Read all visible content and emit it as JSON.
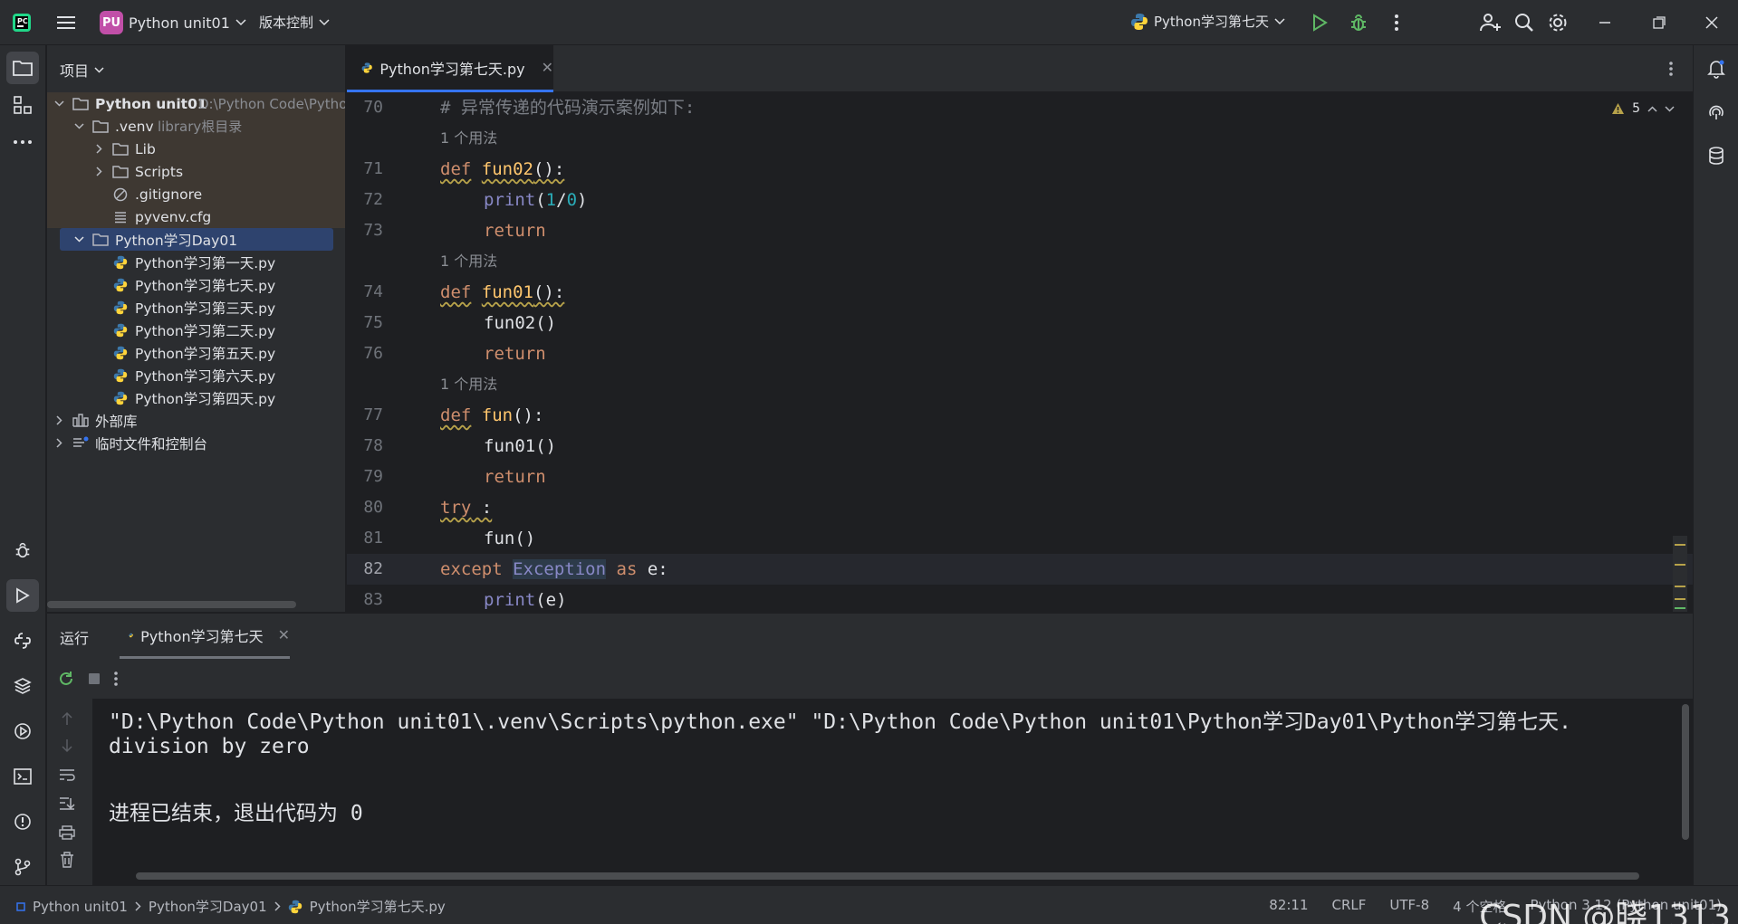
{
  "titlebar": {
    "project_badge": "PU",
    "project_name": "Python unit01",
    "vcs_label": "版本控制",
    "run_config": "Python学习第七天"
  },
  "project_panel": {
    "header": "项目",
    "root": {
      "name": "Python unit01",
      "path": "D:\\Python Code\\Pytho"
    },
    "venv": {
      "name": ".venv",
      "note": "library根目录"
    },
    "lib": "Lib",
    "scripts": "Scripts",
    "gitignore": ".gitignore",
    "pyvenv": "pyvenv.cfg",
    "day_folder": "Python学习Day01",
    "files": [
      "Python学习第一天.py",
      "Python学习第七天.py",
      "Python学习第三天.py",
      "Python学习第二天.py",
      "Python学习第五天.py",
      "Python学习第六天.py",
      "Python学习第四天.py"
    ],
    "external_libs": "外部库",
    "scratches": "临时文件和控制台"
  },
  "editor": {
    "tab_label": "Python学习第七天.py",
    "warning_count": "5",
    "usage_hint": "1 个用法",
    "lines": {
      "l70": {
        "num": "70",
        "text": "# 异常传递的代码演示案例如下:"
      },
      "l71": {
        "num": "71",
        "kw": "def",
        "fn": "fun02",
        "rest": "():"
      },
      "l72": {
        "num": "72",
        "call": "print",
        "open": "(",
        "a": "1",
        "op": "/",
        "b": "0",
        "close": ")"
      },
      "l73": {
        "num": "73",
        "kw": "return"
      },
      "l74": {
        "num": "74",
        "kw": "def",
        "fn": "fun01",
        "rest": "():"
      },
      "l75": {
        "num": "75",
        "text": "fun02()"
      },
      "l76": {
        "num": "76",
        "kw": "return"
      },
      "l77": {
        "num": "77",
        "kw": "def",
        "fn": "fun",
        "rest": "():"
      },
      "l78": {
        "num": "78",
        "text": "fun01()"
      },
      "l79": {
        "num": "79",
        "kw": "return"
      },
      "l80": {
        "num": "80",
        "kw": "try",
        "rest": " :"
      },
      "l81": {
        "num": "81",
        "text": "fun()"
      },
      "l82": {
        "num": "82",
        "kw": "except",
        "cls": "Exception",
        "as": "as",
        "rest": " e:"
      },
      "l83": {
        "num": "83",
        "call": "print",
        "rest": "(e)"
      }
    }
  },
  "run_panel": {
    "header": "运行",
    "tab_label": "Python学习第七天",
    "console": [
      "\"D:\\Python Code\\Python unit01\\.venv\\Scripts\\python.exe\" \"D:\\Python Code\\Python unit01\\Python学习Day01\\Python学习第七天.",
      "division by zero",
      "",
      "进程已结束，退出代码为 0"
    ]
  },
  "statusbar": {
    "crumb1": "Python unit01",
    "crumb2": "Python学习Day01",
    "crumb3": "Python学习第七天.py",
    "position": "82:11",
    "line_sep": "CRLF",
    "encoding": "UTF-8",
    "indent": "4 个空格",
    "interpreter": "Python 3.12 (Python unit01)"
  },
  "watermark": "CSDN @晓1313",
  "colors": {
    "accent": "#3574f0",
    "keyword": "#cf8e6d",
    "function_def": "#ffc66d",
    "builtin": "#8888c6",
    "number": "#2aacb8",
    "run_green": "#5fb865",
    "debug_green": "#5fb865"
  }
}
